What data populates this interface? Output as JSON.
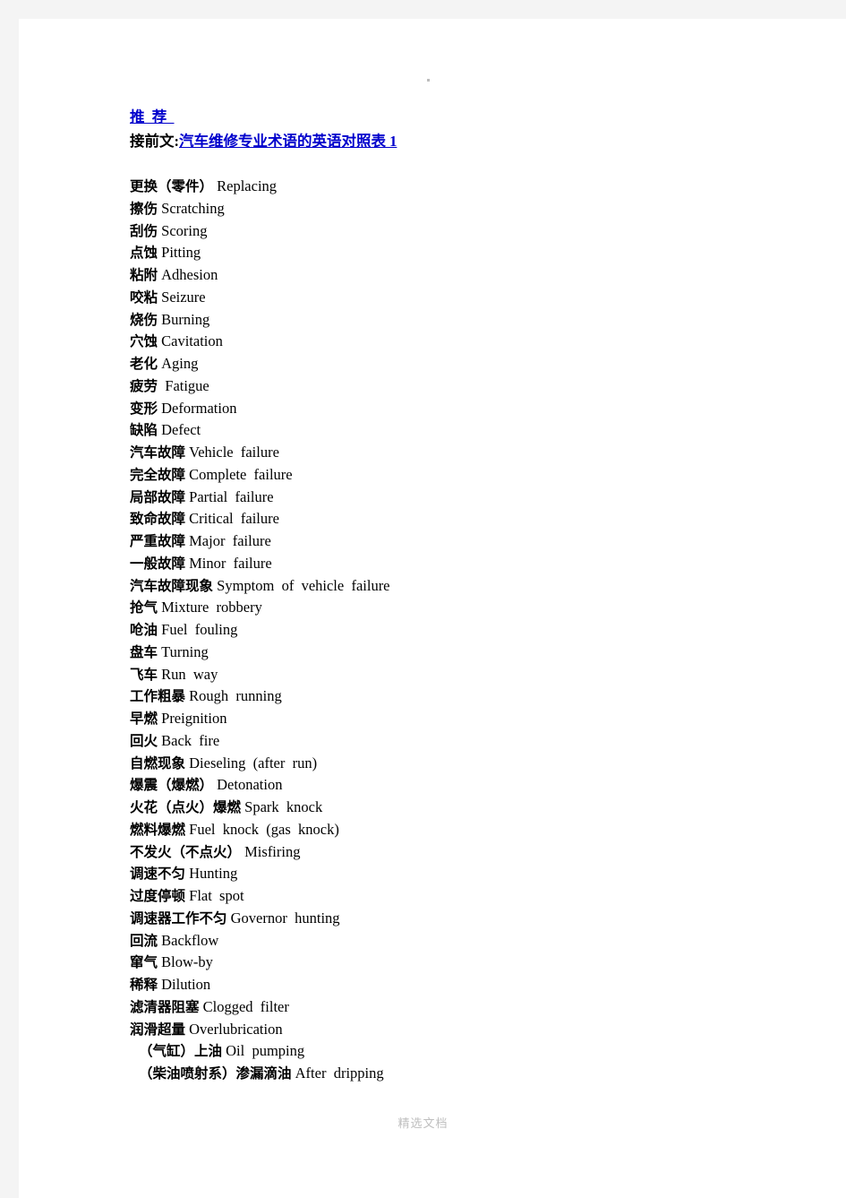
{
  "page": {
    "top_mark": "·",
    "footer_note": "精选文档"
  },
  "header": {
    "recommend_link": "推  荐  ",
    "continue_label": "接前文:",
    "continue_link": "汽车维修专业术语的英语对照表 1"
  },
  "glossary": {
    "entries": [
      {
        "cn": "更换（零件）",
        "en": "Replacing",
        "indent": false
      },
      {
        "cn": "擦伤",
        "en": "Scratching",
        "indent": false
      },
      {
        "cn": "刮伤",
        "en": "Scoring",
        "indent": false
      },
      {
        "cn": "点蚀",
        "en": "Pitting",
        "indent": false
      },
      {
        "cn": "粘附",
        "en": "Adhesion",
        "indent": false
      },
      {
        "cn": "咬粘",
        "en": "Seizure",
        "indent": false
      },
      {
        "cn": "烧伤",
        "en": "Burning",
        "indent": false
      },
      {
        "cn": "穴蚀",
        "en": "Cavitation",
        "indent": false
      },
      {
        "cn": "老化",
        "en": "Aging",
        "indent": false
      },
      {
        "cn": "疲劳",
        "en": " Fatigue",
        "indent": false
      },
      {
        "cn": "变形",
        "en": "Deformation",
        "indent": false
      },
      {
        "cn": "缺陷",
        "en": "Defect",
        "indent": false
      },
      {
        "cn": "汽车故障",
        "en": "Vehicle  failure",
        "indent": false
      },
      {
        "cn": "完全故障",
        "en": "Complete  failure",
        "indent": false
      },
      {
        "cn": "局部故障",
        "en": "Partial  failure",
        "indent": false
      },
      {
        "cn": "致命故障",
        "en": "Critical  failure",
        "indent": false
      },
      {
        "cn": "严重故障",
        "en": "Major  failure",
        "indent": false
      },
      {
        "cn": "一般故障",
        "en": "Minor  failure",
        "indent": false
      },
      {
        "cn": "汽车故障现象",
        "en": "Symptom  of  vehicle  failure",
        "indent": false
      },
      {
        "cn": "抢气",
        "en": "Mixture  robbery",
        "indent": false
      },
      {
        "cn": "呛油",
        "en": "Fuel  fouling",
        "indent": false
      },
      {
        "cn": "盘车",
        "en": "Turning",
        "indent": false
      },
      {
        "cn": "飞车",
        "en": "Run  way",
        "indent": false
      },
      {
        "cn": "工作粗暴",
        "en": "Rough  running",
        "indent": false
      },
      {
        "cn": "早燃",
        "en": "Preignition",
        "indent": false
      },
      {
        "cn": "回火",
        "en": "Back  fire",
        "indent": false
      },
      {
        "cn": "自燃现象",
        "en": "Dieseling  (after  run)",
        "indent": false
      },
      {
        "cn": "爆震（爆燃）",
        "en": "Detonation",
        "indent": false
      },
      {
        "cn": "火花（点火）爆燃",
        "en": "Spark  knock",
        "indent": false
      },
      {
        "cn": "燃料爆燃",
        "en": "Fuel  knock  (gas  knock)",
        "indent": false
      },
      {
        "cn": "不发火（不点火）",
        "en": "Misfiring",
        "indent": false
      },
      {
        "cn": "调速不匀",
        "en": "Hunting",
        "indent": false
      },
      {
        "cn": "过度停顿",
        "en": "Flat  spot",
        "indent": false
      },
      {
        "cn": "调速器工作不匀",
        "en": "Governor  hunting",
        "indent": false
      },
      {
        "cn": "回流",
        "en": "Backflow",
        "indent": false
      },
      {
        "cn": "窜气",
        "en": "Blow-by",
        "indent": false
      },
      {
        "cn": "稀释",
        "en": "Dilution",
        "indent": false
      },
      {
        "cn": "滤清器阻塞",
        "en": "Clogged  filter",
        "indent": false
      },
      {
        "cn": "润滑超量",
        "en": "Overlubrication",
        "indent": false
      },
      {
        "cn": "（气缸）上油",
        "en": "Oil  pumping",
        "indent": true
      },
      {
        "cn": "（柴油喷射系）渗漏滴油",
        "en": "After  dripping",
        "indent": true
      }
    ]
  }
}
